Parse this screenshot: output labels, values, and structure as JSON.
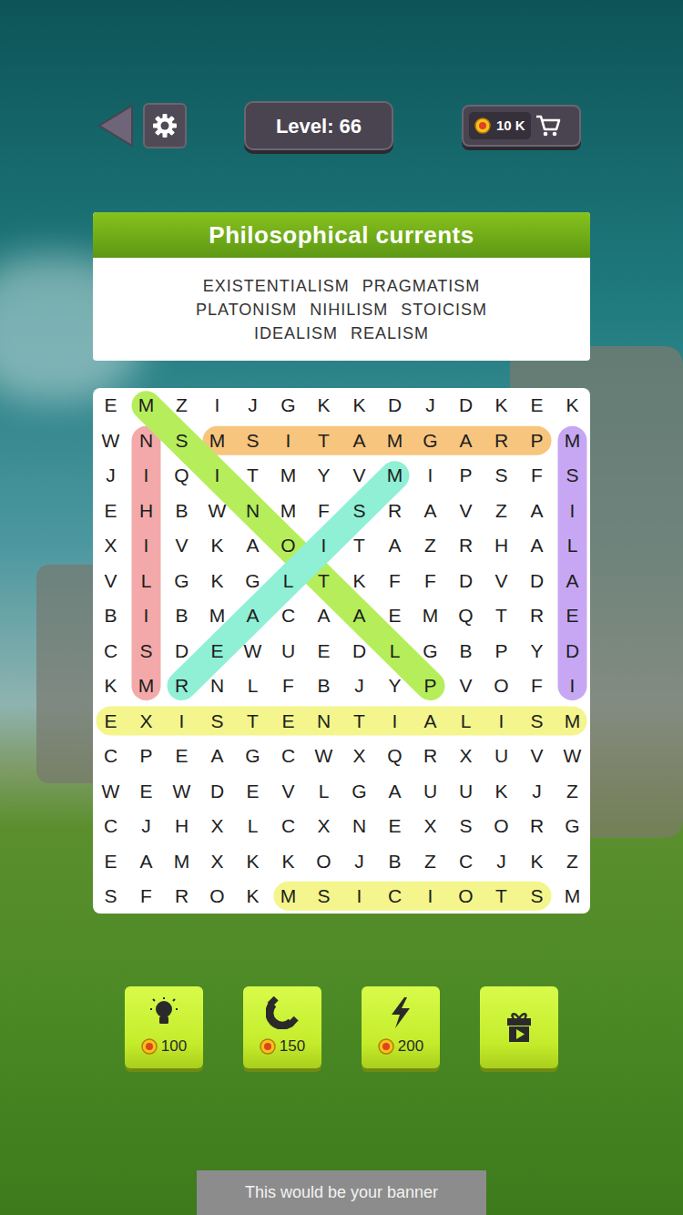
{
  "header": {
    "level": "Level: 66",
    "coins": "10 K"
  },
  "puzzle": {
    "title": "Philosophical currents",
    "word_lines": [
      [
        "EXISTENTIALISM",
        "PRAGMATISM"
      ],
      [
        "PLATONISM",
        "NIHILISM",
        "STOICISM"
      ],
      [
        "IDEALISM",
        "REALISM"
      ]
    ]
  },
  "grid": {
    "rows": [
      [
        "E",
        "M",
        "Z",
        "I",
        "J",
        "G",
        "K",
        "K",
        "D",
        "J",
        "D",
        "K",
        "E",
        "K"
      ],
      [
        "W",
        "N",
        "S",
        "M",
        "S",
        "I",
        "T",
        "A",
        "M",
        "G",
        "A",
        "R",
        "P",
        "M"
      ],
      [
        "J",
        "I",
        "Q",
        "I",
        "T",
        "M",
        "Y",
        "V",
        "M",
        "I",
        "P",
        "S",
        "F",
        "S"
      ],
      [
        "E",
        "H",
        "B",
        "W",
        "N",
        "M",
        "F",
        "S",
        "R",
        "A",
        "V",
        "Z",
        "A",
        "I"
      ],
      [
        "X",
        "I",
        "V",
        "K",
        "A",
        "O",
        "I",
        "T",
        "A",
        "Z",
        "R",
        "H",
        "A",
        "L"
      ],
      [
        "V",
        "L",
        "G",
        "K",
        "G",
        "L",
        "T",
        "K",
        "F",
        "F",
        "D",
        "V",
        "D",
        "A"
      ],
      [
        "B",
        "I",
        "B",
        "M",
        "A",
        "C",
        "A",
        "A",
        "E",
        "M",
        "Q",
        "T",
        "R",
        "E"
      ],
      [
        "C",
        "S",
        "D",
        "E",
        "W",
        "U",
        "E",
        "D",
        "L",
        "G",
        "B",
        "P",
        "Y",
        "D"
      ],
      [
        "K",
        "M",
        "R",
        "N",
        "L",
        "F",
        "B",
        "J",
        "Y",
        "P",
        "V",
        "O",
        "F",
        "I"
      ],
      [
        "E",
        "X",
        "I",
        "S",
        "T",
        "E",
        "N",
        "T",
        "I",
        "A",
        "L",
        "I",
        "S",
        "M"
      ],
      [
        "C",
        "P",
        "E",
        "A",
        "G",
        "C",
        "W",
        "X",
        "Q",
        "R",
        "X",
        "U",
        "V",
        "W"
      ],
      [
        "W",
        "E",
        "W",
        "D",
        "E",
        "V",
        "L",
        "G",
        "A",
        "U",
        "U",
        "K",
        "J",
        "Z"
      ],
      [
        "C",
        "J",
        "H",
        "X",
        "L",
        "C",
        "X",
        "N",
        "E",
        "X",
        "S",
        "O",
        "R",
        "G"
      ],
      [
        "E",
        "A",
        "M",
        "X",
        "K",
        "K",
        "O",
        "J",
        "B",
        "Z",
        "C",
        "J",
        "K",
        "Z"
      ],
      [
        "S",
        "F",
        "R",
        "O",
        "K",
        "M",
        "S",
        "I",
        "C",
        "I",
        "O",
        "T",
        "S",
        "M"
      ]
    ]
  },
  "found": [
    {
      "color": "#f8c57e",
      "start": [
        1,
        3
      ],
      "end": [
        1,
        12
      ]
    },
    {
      "color": "#f3a9a9",
      "start": [
        1,
        1
      ],
      "end": [
        8,
        1
      ]
    },
    {
      "color": "#c7a7f3",
      "start": [
        1,
        13
      ],
      "end": [
        8,
        13
      ]
    },
    {
      "color": "#f4f58c",
      "start": [
        9,
        0
      ],
      "end": [
        9,
        13
      ]
    },
    {
      "color": "#f4f58c",
      "start": [
        14,
        5
      ],
      "end": [
        14,
        12
      ]
    },
    {
      "color": "#b5ee5a",
      "start": [
        0,
        1
      ],
      "end": [
        8,
        9
      ]
    },
    {
      "color": "#8ff0d6",
      "start": [
        8,
        2
      ],
      "end": [
        2,
        8
      ]
    }
  ],
  "powerups": [
    {
      "kind": "hint",
      "price": "100"
    },
    {
      "kind": "magnet",
      "price": "150"
    },
    {
      "kind": "lightning",
      "price": "200"
    },
    {
      "kind": "video"
    }
  ],
  "banner": "This would be your banner"
}
